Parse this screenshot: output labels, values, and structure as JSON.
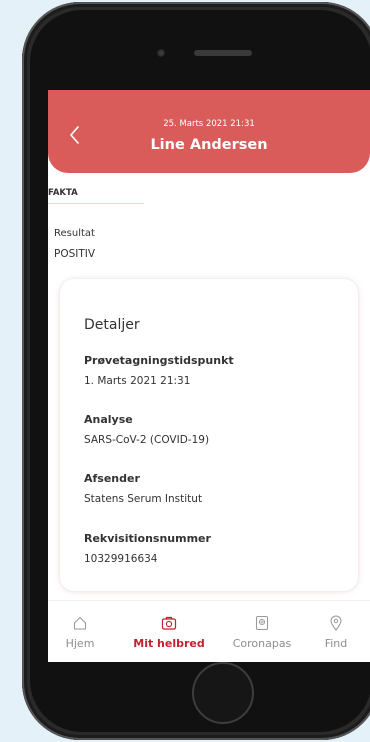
{
  "header": {
    "date": "25. Marts 2021 21:31",
    "name": "Line Andersen"
  },
  "section": {
    "title": "FAKTA"
  },
  "result": {
    "label": "Resultat",
    "value": "POSITIV"
  },
  "details": {
    "title": "Detaljer",
    "items": [
      {
        "label": "Prøvetagningstidspunkt",
        "value": "1. Marts 2021 21:31"
      },
      {
        "label": "Analyse",
        "value": "SARS-CoV-2 (COVID-19)"
      },
      {
        "label": "Afsender",
        "value": "Statens Serum Institut"
      },
      {
        "label": "Rekvisitionsnummer",
        "value": "10329916634"
      }
    ]
  },
  "tabs": [
    {
      "label": "Hjem",
      "icon": "home-icon",
      "active": false
    },
    {
      "label": "Mit helbred",
      "icon": "health-kit-icon",
      "active": true
    },
    {
      "label": "Coronapas",
      "icon": "passport-icon",
      "active": false
    },
    {
      "label": "Find",
      "icon": "location-pin-icon",
      "active": false
    }
  ],
  "colors": {
    "header": "#d95c5a",
    "active_tab": "#c0232c",
    "page_background": "#e4f1f8"
  }
}
